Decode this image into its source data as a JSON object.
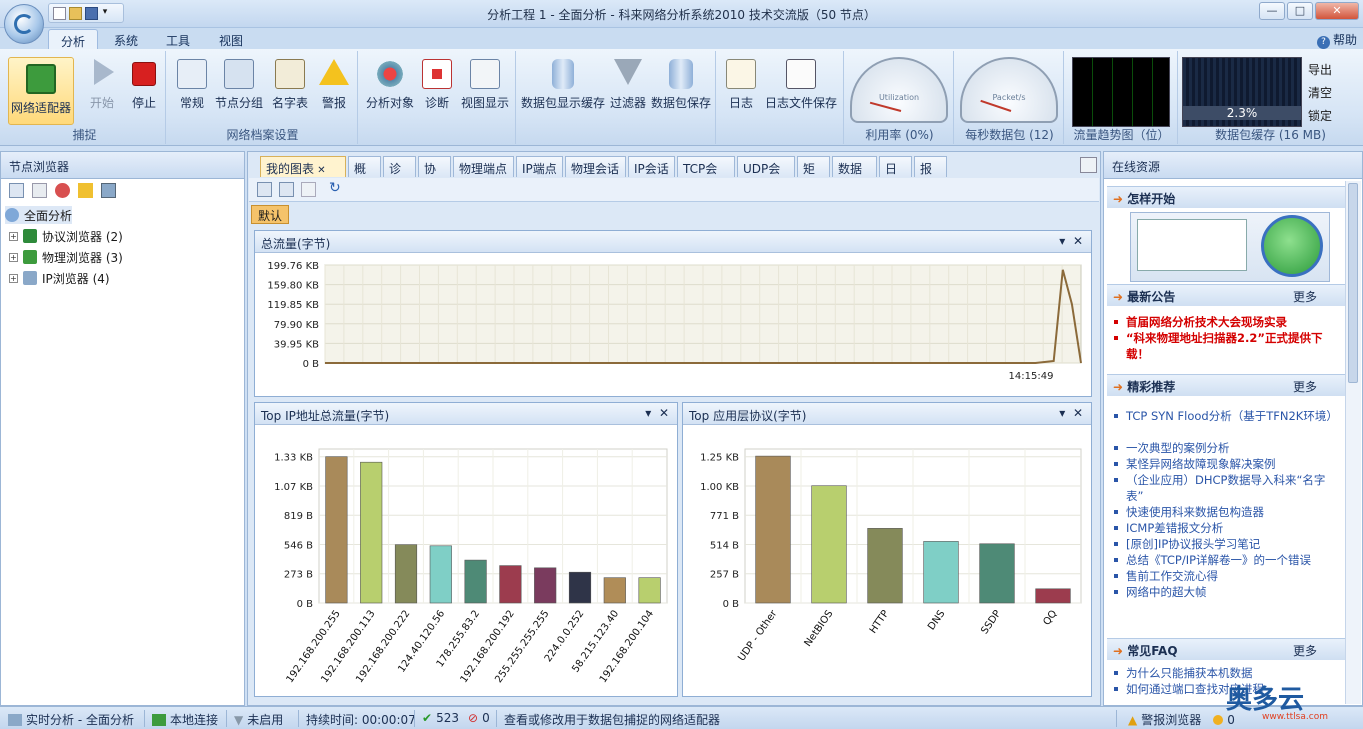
{
  "window": {
    "title": "分析工程 1 - 全面分析 - 科来网络分析系统2010 技术交流版（50 节点）"
  },
  "ribbon_tabs": [
    "分析",
    "系统",
    "工具",
    "视图"
  ],
  "help_label": "帮助",
  "ribbon_groups": {
    "capture": {
      "label": "捕捉",
      "buttons": [
        "网络适配器",
        "开始",
        "停止"
      ]
    },
    "profile": {
      "label": "网络档案设置",
      "buttons": [
        "常规",
        "节点分组",
        "名字表",
        "警报"
      ]
    },
    "analysis": {
      "buttons": [
        "分析对象",
        "诊断",
        "视图显示"
      ]
    },
    "packet": {
      "buttons": [
        "数据包显示缓存",
        "过滤器",
        "数据包保存"
      ]
    },
    "log": {
      "buttons": [
        "日志",
        "日志文件保存"
      ]
    },
    "utilization": {
      "label": "利用率 (0%)",
      "gauge_text": "Utilization",
      "value": 0
    },
    "pps": {
      "label": "每秒数据包 (12)",
      "gauge_text": "Packet/s",
      "value": 12
    },
    "trend": {
      "label": "流量趋势图（位）"
    },
    "buffer": {
      "label": "数据包缓存 (16 MB)",
      "percent": "2.3%",
      "side_buttons": [
        "导出",
        "清空",
        "锁定"
      ]
    }
  },
  "node_browser": {
    "title": "节点浏览器",
    "root": "全面分析",
    "children": [
      "协议浏览器 (2)",
      "物理浏览器 (3)",
      "IP浏览器 (4)"
    ]
  },
  "doc_tabs": [
    "我的图表",
    "概要",
    "诊断",
    "协议",
    "物理端点",
    "IP端点",
    "物理会话",
    "IP会话",
    "TCP会话",
    "UDP会话",
    "矩阵",
    "数据包",
    "日志",
    "报表"
  ],
  "default_label": "默认",
  "chart_data": [
    {
      "type": "line",
      "title": "总流量(字节)",
      "y_ticks": [
        "199.76 KB",
        "159.80 KB",
        "119.85 KB",
        "79.90 KB",
        "39.95 KB",
        "0 B"
      ],
      "ylim": [
        0,
        199.76
      ],
      "x_tick": "14:15:49",
      "series": [
        {
          "values": [
            0,
            0,
            0,
            0,
            0,
            0,
            0,
            0,
            0,
            0,
            0,
            0,
            0,
            0,
            0,
            0,
            0,
            0,
            0,
            0,
            0,
            0,
            0,
            0,
            0,
            0,
            0,
            0,
            0,
            0,
            0,
            0,
            0,
            0,
            0,
            0,
            0,
            0,
            0,
            0,
            0,
            0,
            0,
            0,
            0,
            0,
            0,
            0,
            0,
            0,
            0,
            0,
            0,
            0,
            0,
            0,
            0,
            0,
            0,
            0,
            0,
            0,
            0,
            0,
            0,
            0,
            0,
            0,
            0,
            0,
            0,
            0,
            0,
            0,
            0,
            0,
            0,
            0,
            0,
            2,
            4,
            190,
            120,
            0
          ]
        }
      ],
      "color": "#8b6a3a"
    },
    {
      "type": "bar",
      "title": "Top IP地址总流量(字节)",
      "y_ticks": [
        "1.33 KB",
        "1.07 KB",
        "819 B",
        "546 B",
        "273 B",
        "0 B"
      ],
      "ylim": [
        0,
        1.4
      ],
      "categories": [
        "192.168.200.255",
        "192.168.200.113",
        "192.168.200.222",
        "124.40.120.56",
        "178.255.83.2",
        "192.168.200.192",
        "255.255.255.255",
        "224.0.0.252",
        "58.215.123.40",
        "192.168.200.104"
      ],
      "values": [
        1.33,
        1.28,
        0.53,
        0.52,
        0.39,
        0.34,
        0.32,
        0.28,
        0.23,
        0.23
      ],
      "colors": [
        "#a98a5a",
        "#b8cf6e",
        "#858a5a",
        "#7fcfc6",
        "#4e8a76",
        "#9c3c4e",
        "#7a3b5e",
        "#2f3448",
        "#b08d58",
        "#b8cf6e"
      ]
    },
    {
      "type": "bar",
      "title": "Top 应用层协议(字节)",
      "y_ticks": [
        "1.25 KB",
        "1.00 KB",
        "771 B",
        "514 B",
        "257 B",
        "0 B"
      ],
      "ylim": [
        0,
        1.3
      ],
      "categories": [
        "UDP - Other",
        "NetBIOS",
        "HTTP",
        "DNS",
        "SSDP",
        "QQ"
      ],
      "values": [
        1.24,
        0.99,
        0.63,
        0.52,
        0.5,
        0.12
      ],
      "colors": [
        "#a98a5a",
        "#b8cf6e",
        "#858a5a",
        "#7fcfc6",
        "#4e8a76",
        "#9c3c4e"
      ]
    }
  ],
  "online": {
    "title": "在线资源",
    "howto": "怎样开始",
    "news": {
      "title": "最新公告",
      "more": "更多",
      "items": [
        "首届网络分析技术大会现场实录",
        "“科来物理地址扫描器2.2”正式提供下载！"
      ]
    },
    "featured": {
      "title": "精彩推荐",
      "more": "更多",
      "items": [
        "TCP SYN Flood分析（基于TFN2K环境）",
        "一次典型的案例分析",
        "某怪异网络故障现象解决案例",
        "（企业应用）DHCP数据导入科来“名字表”",
        "快速使用科来数据包构造器",
        "ICMP差错报文分析",
        "[原创]IP协议报头学习笔记",
        "总结《TCP/IP详解卷一》的一个错误",
        "售前工作交流心得",
        "网络中的超大帧"
      ]
    },
    "faq": {
      "title": "常见FAQ",
      "more": "更多",
      "items": [
        "为什么只能捕获本机数据",
        "如何通过端口查找对应进程"
      ]
    }
  },
  "status": {
    "mode": "实时分析 - 全面分析",
    "conn": "本地连接",
    "filter": "未启用",
    "duration": "持续时间: 00:00:07",
    "packets": "523",
    "dropped": "0",
    "hint": "查看或修改用于数据包捕捉的网络适配器",
    "alarm": "警报浏览器",
    "alarm_count": "0"
  },
  "watermark": {
    "text": "奥多云",
    "url": "www.ttlsa.com"
  }
}
